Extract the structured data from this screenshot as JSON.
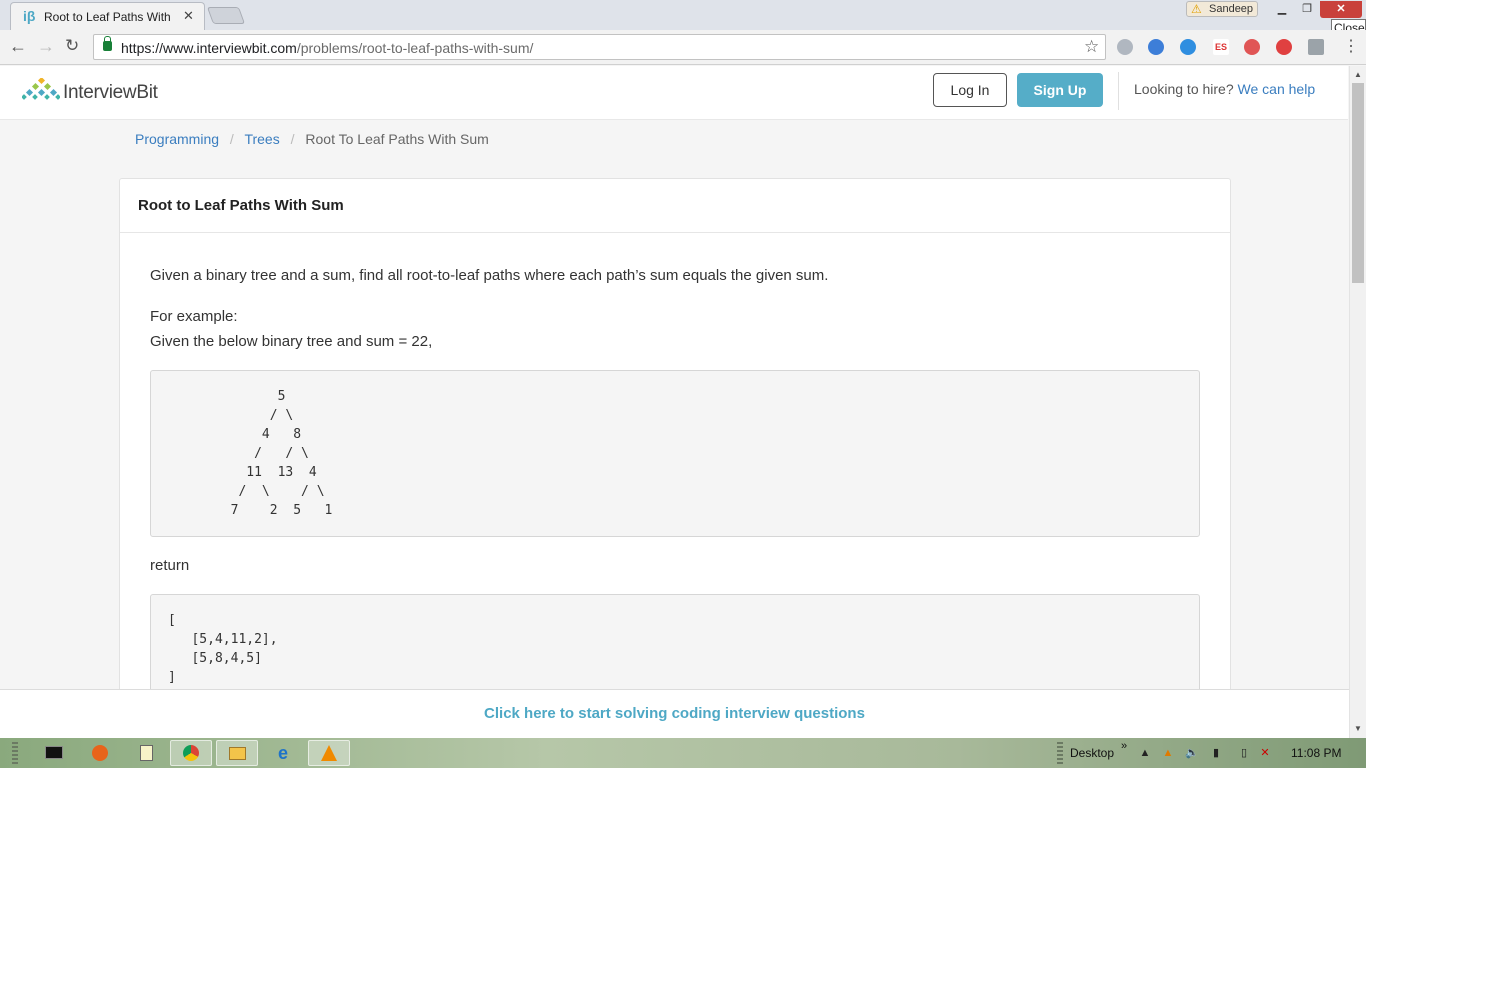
{
  "browser": {
    "tab_title": "Root to Leaf Paths With Sum",
    "tab_favicon": "iβ",
    "profile_name": "Sandeep",
    "close_tooltip": "Close",
    "url_scheme_host": "https://www.interviewbit.com",
    "url_path": "/problems/root-to-leaf-paths-with-sum/"
  },
  "header": {
    "logo_text": "InterviewBit",
    "login_label": "Log In",
    "signup_label": "Sign Up",
    "hire_prompt": "Looking to hire?",
    "hire_link": "We can help"
  },
  "breadcrumb": {
    "items": [
      "Programming",
      "Trees",
      "Root To Leaf Paths With Sum"
    ]
  },
  "problem": {
    "title": "Root to Leaf Paths With Sum",
    "description": "Given a binary tree and a sum, find all root-to-leaf paths where each path’s sum equals the given sum.",
    "example_label": "For example:",
    "example_intro": "Given the below binary tree and sum = 22,",
    "tree_ascii": "              5\n             / \\\n            4   8\n           /   / \\\n          11  13  4\n         /  \\    / \\\n        7    2  5   1",
    "return_label": "return",
    "return_code": "[\n   [5,4,11,2],\n   [5,8,4,5]\n]"
  },
  "footer": {
    "cta": "Click here to start solving coding interview questions"
  },
  "taskbar": {
    "desktop_label": "Desktop",
    "chevrons": "»",
    "clock": "11:08 PM"
  },
  "colors": {
    "accent": "#55adc8",
    "link": "#3a7dbf",
    "close_button": "#c9413b"
  }
}
